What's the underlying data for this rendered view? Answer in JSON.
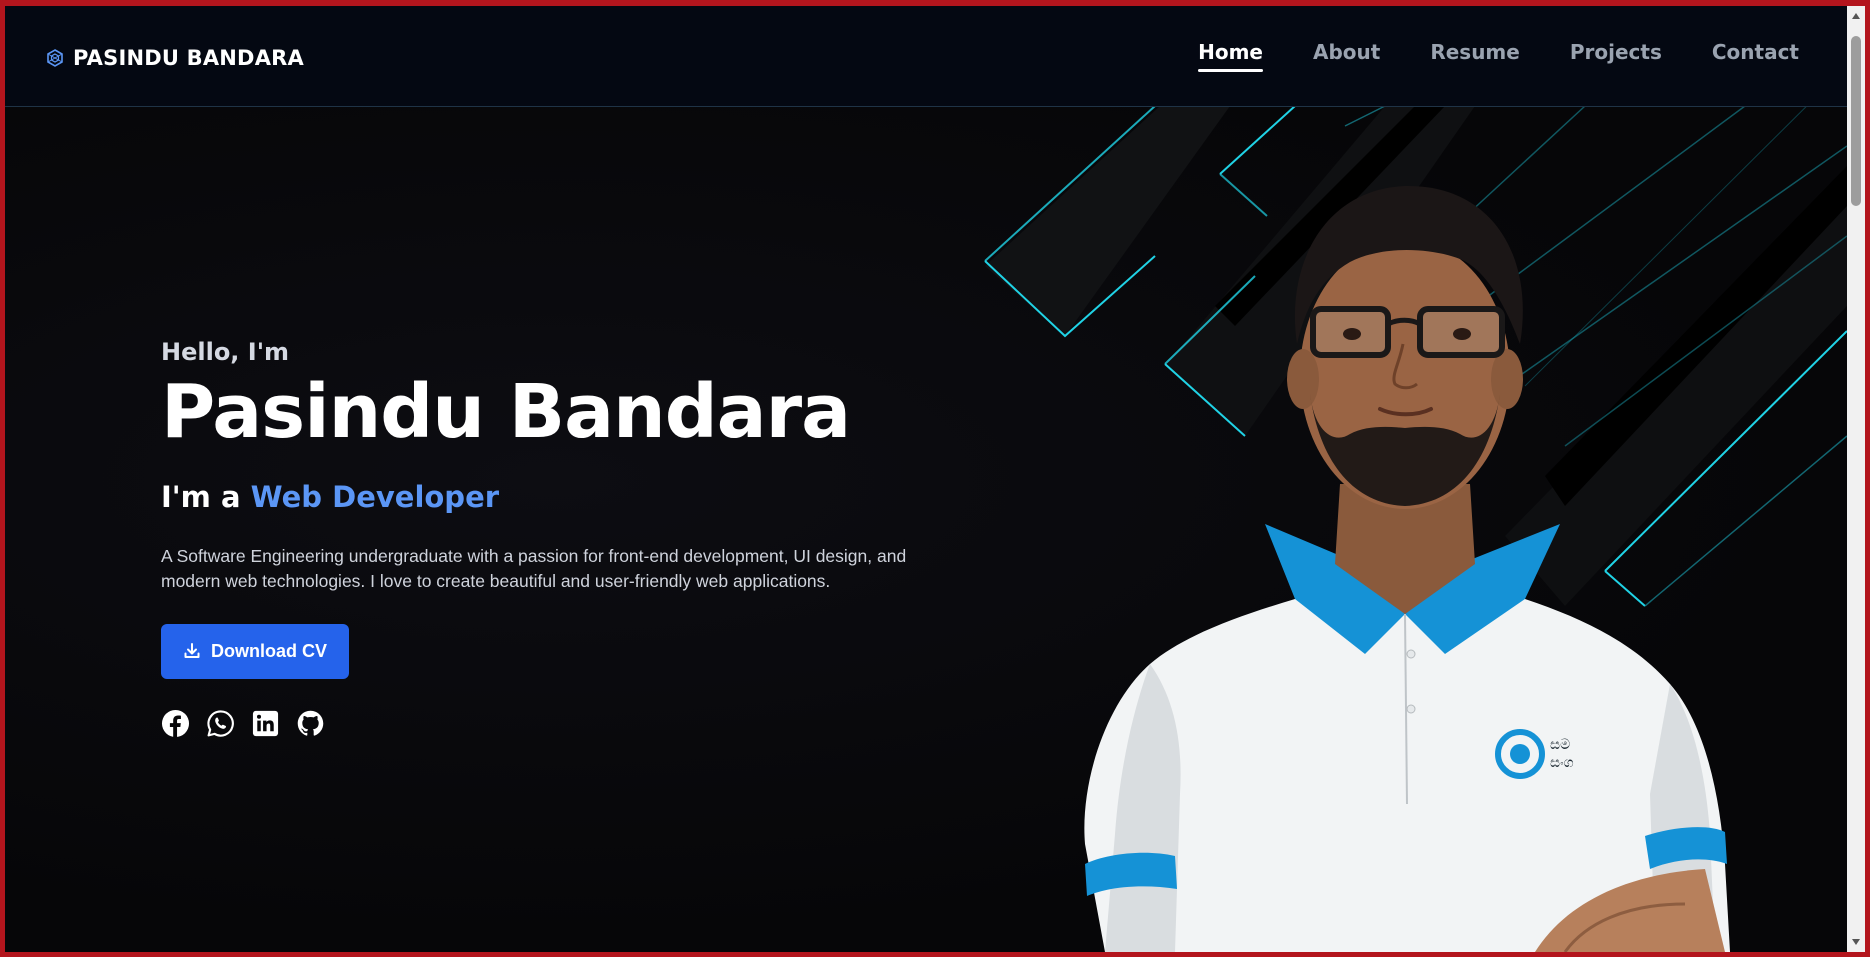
{
  "brand": {
    "name": "PASINDU BANDARA",
    "icon": "hexagon-logo-icon"
  },
  "nav": {
    "items": [
      {
        "label": "Home",
        "active": true
      },
      {
        "label": "About",
        "active": false
      },
      {
        "label": "Resume",
        "active": false
      },
      {
        "label": "Projects",
        "active": false
      },
      {
        "label": "Contact",
        "active": false
      }
    ]
  },
  "hero": {
    "greeting": "Hello, I'm",
    "name": "Pasindu Bandara",
    "role_prefix": "I'm a ",
    "role": "Web Developer",
    "description": "A Software Engineering undergraduate with a passion for front-end development, UI design, and modern web technologies. I love to create beautiful and user-friendly web applications.",
    "cv_button": "Download CV",
    "cv_icon": "download-icon"
  },
  "socials": [
    {
      "name": "facebook-icon"
    },
    {
      "name": "whatsapp-icon"
    },
    {
      "name": "linkedin-icon"
    },
    {
      "name": "github-icon"
    }
  ],
  "colors": {
    "accent": "#5b96f5",
    "button": "#2563eb",
    "stripe_glow": "#20d3e6",
    "frame": "#b3151d"
  }
}
